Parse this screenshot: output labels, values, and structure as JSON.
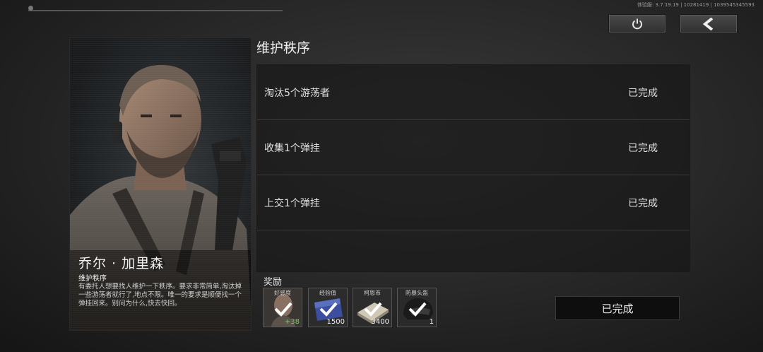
{
  "header": {
    "version_text": "体验服: 3.7.19.19 | 10281419 | 1039545345593"
  },
  "npc": {
    "name": "乔尔 · 加里森",
    "quest_type": "维护秩序",
    "description": "有委托人想要找人维护一下秩序。要求非常简单,淘汰掉一些游荡者就行了,地点不限。唯一的要求是顺便找一个弹挂回来。别问为什么,快去快回。"
  },
  "quest": {
    "title": "维护秩序",
    "tasks": [
      {
        "label": "淘汰5个游荡者",
        "status": "已完成"
      },
      {
        "label": "收集1个弹挂",
        "status": "已完成"
      },
      {
        "label": "上交1个弹挂",
        "status": "已完成"
      }
    ]
  },
  "rewards": {
    "label": "奖励",
    "items": [
      {
        "name": "好感度",
        "qty": "+38",
        "icon": "portrait-icon"
      },
      {
        "name": "经验值",
        "qty": "1500",
        "icon": "exp-card-icon"
      },
      {
        "name": "柯恩币",
        "qty": "3400",
        "icon": "cash-stack-icon"
      },
      {
        "name": "防暴头盔",
        "qty": "1",
        "icon": "helmet-icon"
      }
    ]
  },
  "complete_button": "已完成",
  "colors": {
    "background": "#262626",
    "panel": "#1e1e1e",
    "positive": "#7ec96a",
    "text": "#e6e6e6"
  }
}
